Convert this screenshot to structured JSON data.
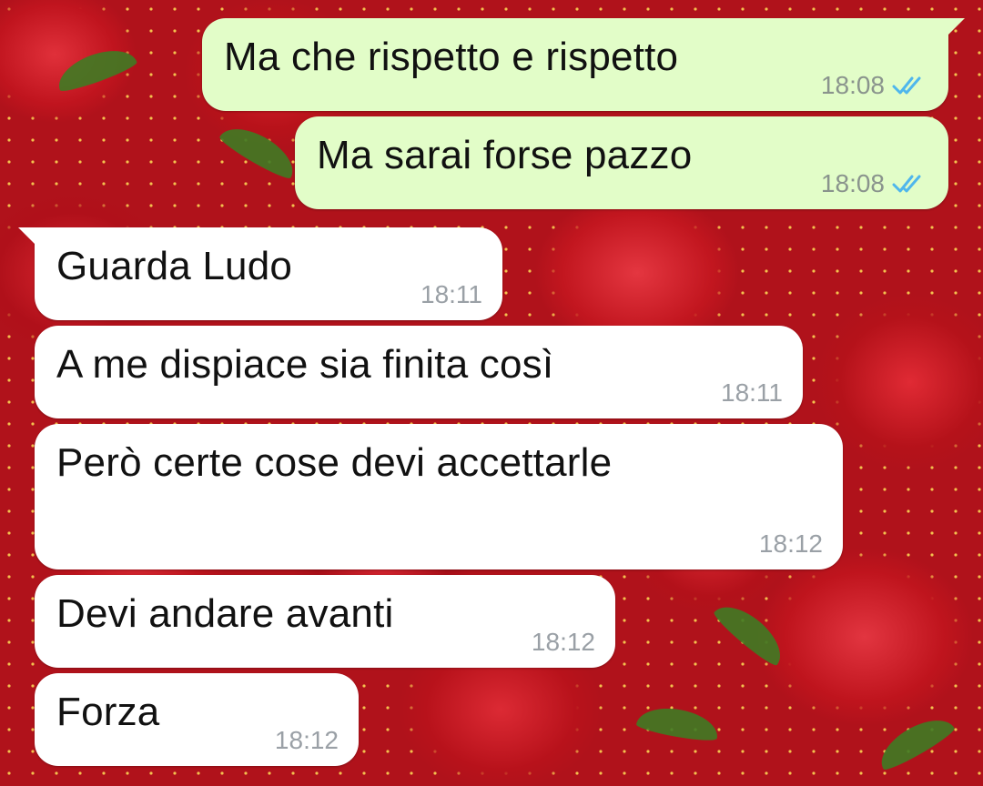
{
  "chat": {
    "messages": [
      {
        "text": "Ma che rispetto e rispetto",
        "time": "18:08",
        "direction": "outgoing",
        "status": "read"
      },
      {
        "text": "Ma sarai forse pazzo",
        "time": "18:08",
        "direction": "outgoing",
        "status": "read"
      },
      {
        "text": "Guarda Ludo",
        "time": "18:11",
        "direction": "incoming"
      },
      {
        "text": "A me dispiace sia finita così",
        "time": "18:11",
        "direction": "incoming"
      },
      {
        "text": "Però certe cose devi accettarle",
        "time": "18:12",
        "direction": "incoming"
      },
      {
        "text": "Devi andare avanti",
        "time": "18:12",
        "direction": "incoming"
      },
      {
        "text": "Forza",
        "time": "18:12",
        "direction": "incoming"
      }
    ]
  },
  "colors": {
    "outgoing_bubble": "#e2fdc8",
    "incoming_bubble": "#ffffff",
    "read_tick": "#4fb6ec",
    "wallpaper": "#b0121b"
  },
  "icons": {
    "read_receipt": "double-check-icon"
  }
}
